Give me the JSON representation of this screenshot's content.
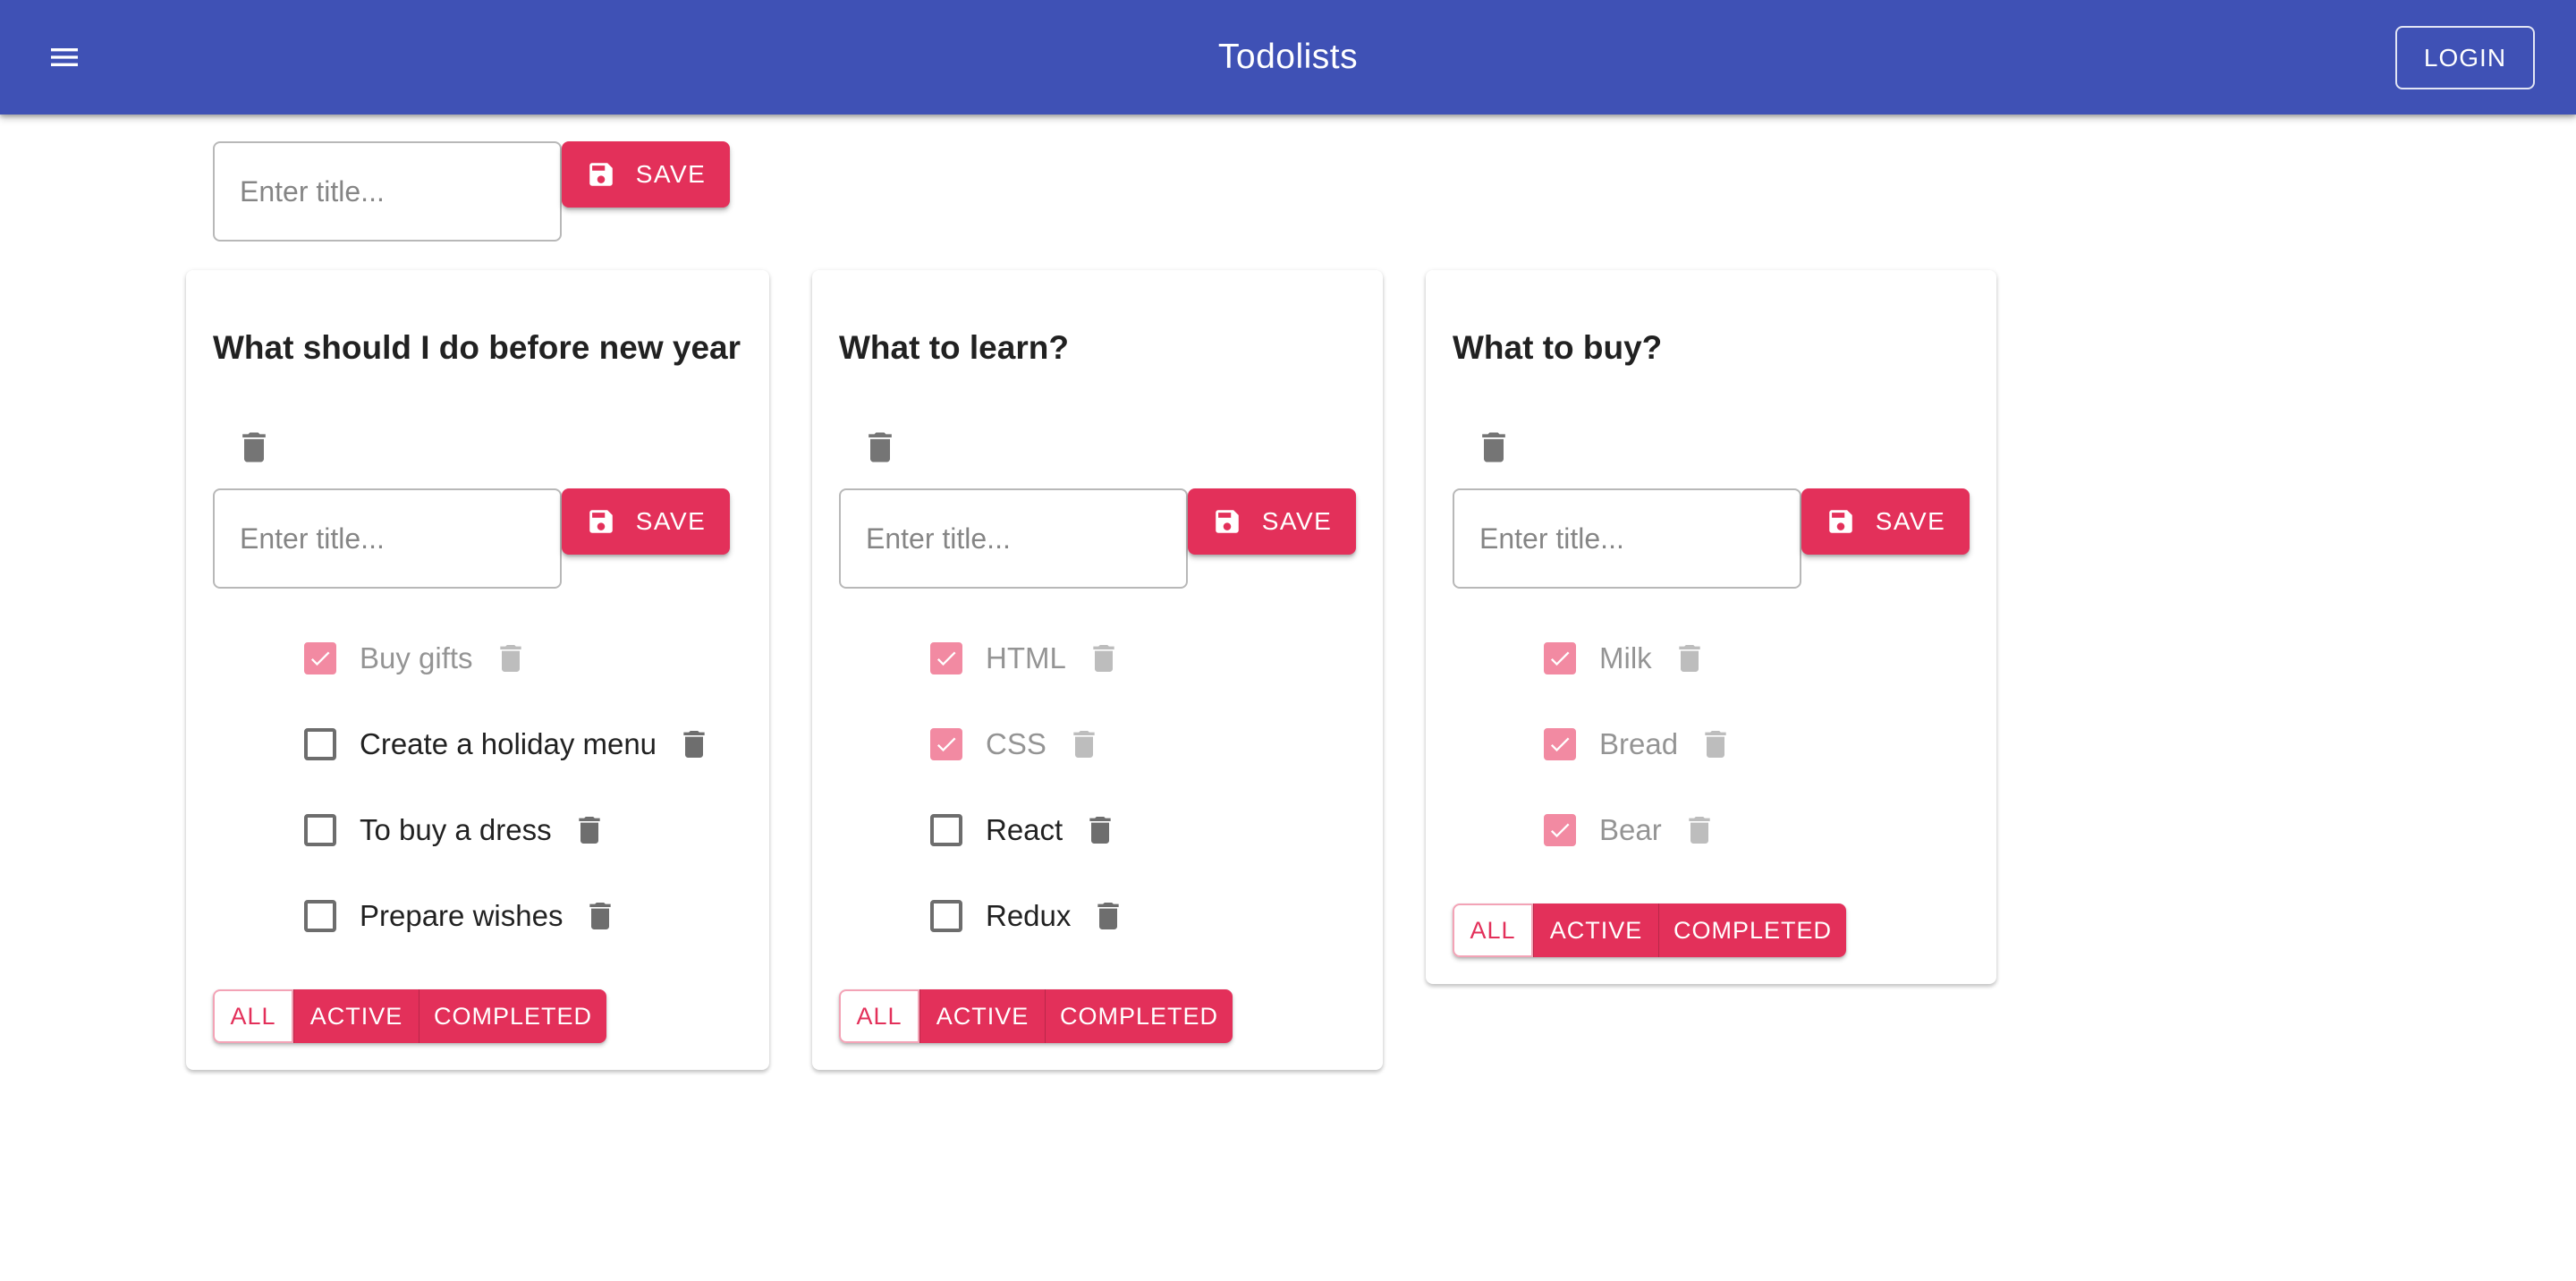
{
  "appbar": {
    "title": "Todolists",
    "login_label": "LOGIN",
    "color": "#3f51b5"
  },
  "add_list": {
    "placeholder": "Enter title...",
    "save_label": "SAVE"
  },
  "accent_color": "#e3305a",
  "todolists": [
    {
      "title": "What should I do before new year",
      "input_placeholder": "Enter title...",
      "save_label": "SAVE",
      "tasks": [
        {
          "label": "Buy gifts",
          "done": true
        },
        {
          "label": "Create a holiday menu",
          "done": false
        },
        {
          "label": "To buy a dress",
          "done": false
        },
        {
          "label": "Prepare wishes",
          "done": false
        }
      ],
      "filters": {
        "all": "ALL",
        "active": "ACTIVE",
        "completed": "COMPLETED",
        "selected": "all"
      }
    },
    {
      "title": "What to learn?",
      "input_placeholder": "Enter title...",
      "save_label": "SAVE",
      "tasks": [
        {
          "label": "HTML",
          "done": true
        },
        {
          "label": "CSS",
          "done": true
        },
        {
          "label": "React",
          "done": false
        },
        {
          "label": "Redux",
          "done": false
        }
      ],
      "filters": {
        "all": "ALL",
        "active": "ACTIVE",
        "completed": "COMPLETED",
        "selected": "all"
      }
    },
    {
      "title": "What to buy?",
      "input_placeholder": "Enter title...",
      "save_label": "SAVE",
      "tasks": [
        {
          "label": "Milk",
          "done": true
        },
        {
          "label": "Bread",
          "done": true
        },
        {
          "label": "Bear",
          "done": true
        }
      ],
      "filters": {
        "all": "ALL",
        "active": "ACTIVE",
        "completed": "COMPLETED",
        "selected": "all"
      }
    }
  ],
  "icons": {
    "menu": "menu-icon",
    "save": "save-icon",
    "delete": "trash-icon",
    "check": "check-icon"
  }
}
